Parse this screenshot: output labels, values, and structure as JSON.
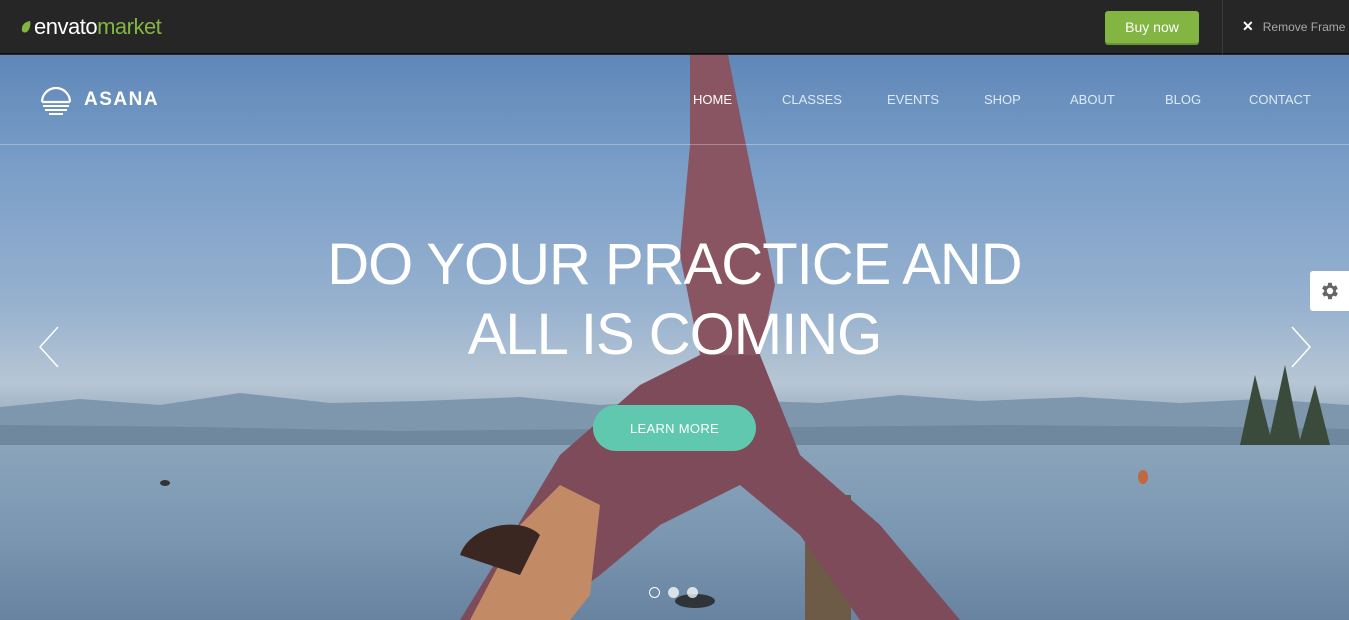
{
  "topbar": {
    "logo_part1": "envato",
    "logo_part2": "market",
    "buy_label": "Buy now",
    "remove_frame_label": "Remove Frame",
    "colors": {
      "brand_green": "#82b541",
      "bar_bg": "#262626"
    }
  },
  "site": {
    "brand": "ASANA",
    "nav": [
      {
        "label": "HOME",
        "active": true
      },
      {
        "label": "CLASSES",
        "active": false
      },
      {
        "label": "EVENTS",
        "active": false
      },
      {
        "label": "SHOP",
        "active": false
      },
      {
        "label": "ABOUT",
        "active": false
      },
      {
        "label": "BLOG",
        "active": false
      },
      {
        "label": "CONTACT",
        "active": false
      }
    ]
  },
  "hero": {
    "headline_line1": "DO YOUR PRACTICE AND",
    "headline_line2": "ALL IS COMING",
    "cta_label": "LEARN MORE",
    "cta_color": "#5fc8ae",
    "slides_total": 3,
    "active_slide": 1
  },
  "icons": {
    "prev": "chevron-left-icon",
    "next": "chevron-right-icon",
    "settings": "gear-icon",
    "close": "close-icon"
  }
}
